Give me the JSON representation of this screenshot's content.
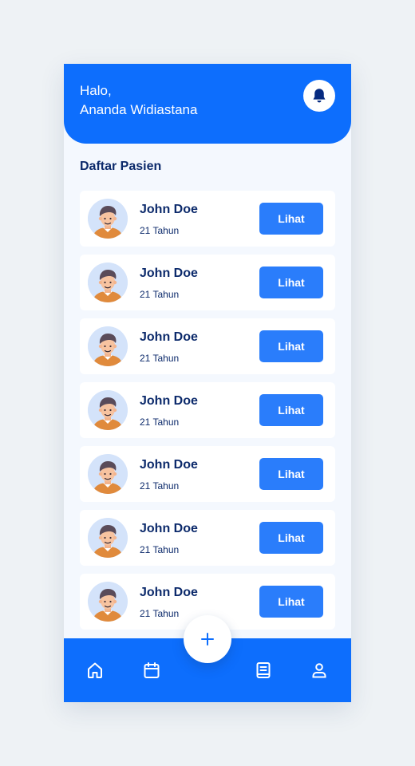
{
  "header": {
    "greeting_line1": "Halo,",
    "greeting_line2": "Ananda Widiastana",
    "notification_icon": "bell-icon"
  },
  "section": {
    "title": "Daftar Pasien"
  },
  "patients": [
    {
      "name": "John Doe",
      "age": "21 Tahun",
      "action": "Lihat"
    },
    {
      "name": "John Doe",
      "age": "21 Tahun",
      "action": "Lihat"
    },
    {
      "name": "John Doe",
      "age": "21 Tahun",
      "action": "Lihat"
    },
    {
      "name": "John Doe",
      "age": "21 Tahun",
      "action": "Lihat"
    },
    {
      "name": "John Doe",
      "age": "21 Tahun",
      "action": "Lihat"
    },
    {
      "name": "John Doe",
      "age": "21 Tahun",
      "action": "Lihat"
    },
    {
      "name": "John Doe",
      "age": "21 Tahun",
      "action": "Lihat"
    }
  ],
  "bottom_nav": {
    "items": [
      "home-icon",
      "calendar-icon",
      "book-icon",
      "user-icon"
    ],
    "fab_icon": "plus-icon"
  },
  "colors": {
    "primary": "#0d6efd",
    "button": "#2a7dfb",
    "text_dark": "#0c2a6b",
    "background": "#f4f8fe"
  }
}
